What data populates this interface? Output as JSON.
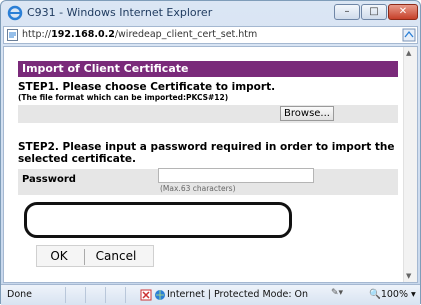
{
  "window": {
    "title": "C931 - Windows Internet Explorer",
    "minimize_glyph": "–",
    "maximize_glyph": "□",
    "close_glyph": "✕"
  },
  "address": {
    "url_prefix": "http://",
    "url_host": "192.168.0.2",
    "url_path": "/wiredeap_client_cert_set.htm"
  },
  "page": {
    "header": "Import of Client Certificate",
    "step1_title": "STEP1. Please choose Certificate to import.",
    "step1_note": "(The file format which can be imported:PKCS#12)",
    "browse_label": "Browse...",
    "step2_title": "STEP2. Please input a password required in order to import the selected certificate.",
    "password_label": "Password",
    "password_value": "",
    "password_hint": "(Max.63 characters)",
    "ok_label": "OK",
    "cancel_label": "Cancel"
  },
  "status": {
    "done": "Done",
    "zone": "Internet | Protected Mode: On",
    "zoom": "100%"
  },
  "colors": {
    "header_bg": "#7a2a7a",
    "row_bg": "#e6e6e6"
  }
}
